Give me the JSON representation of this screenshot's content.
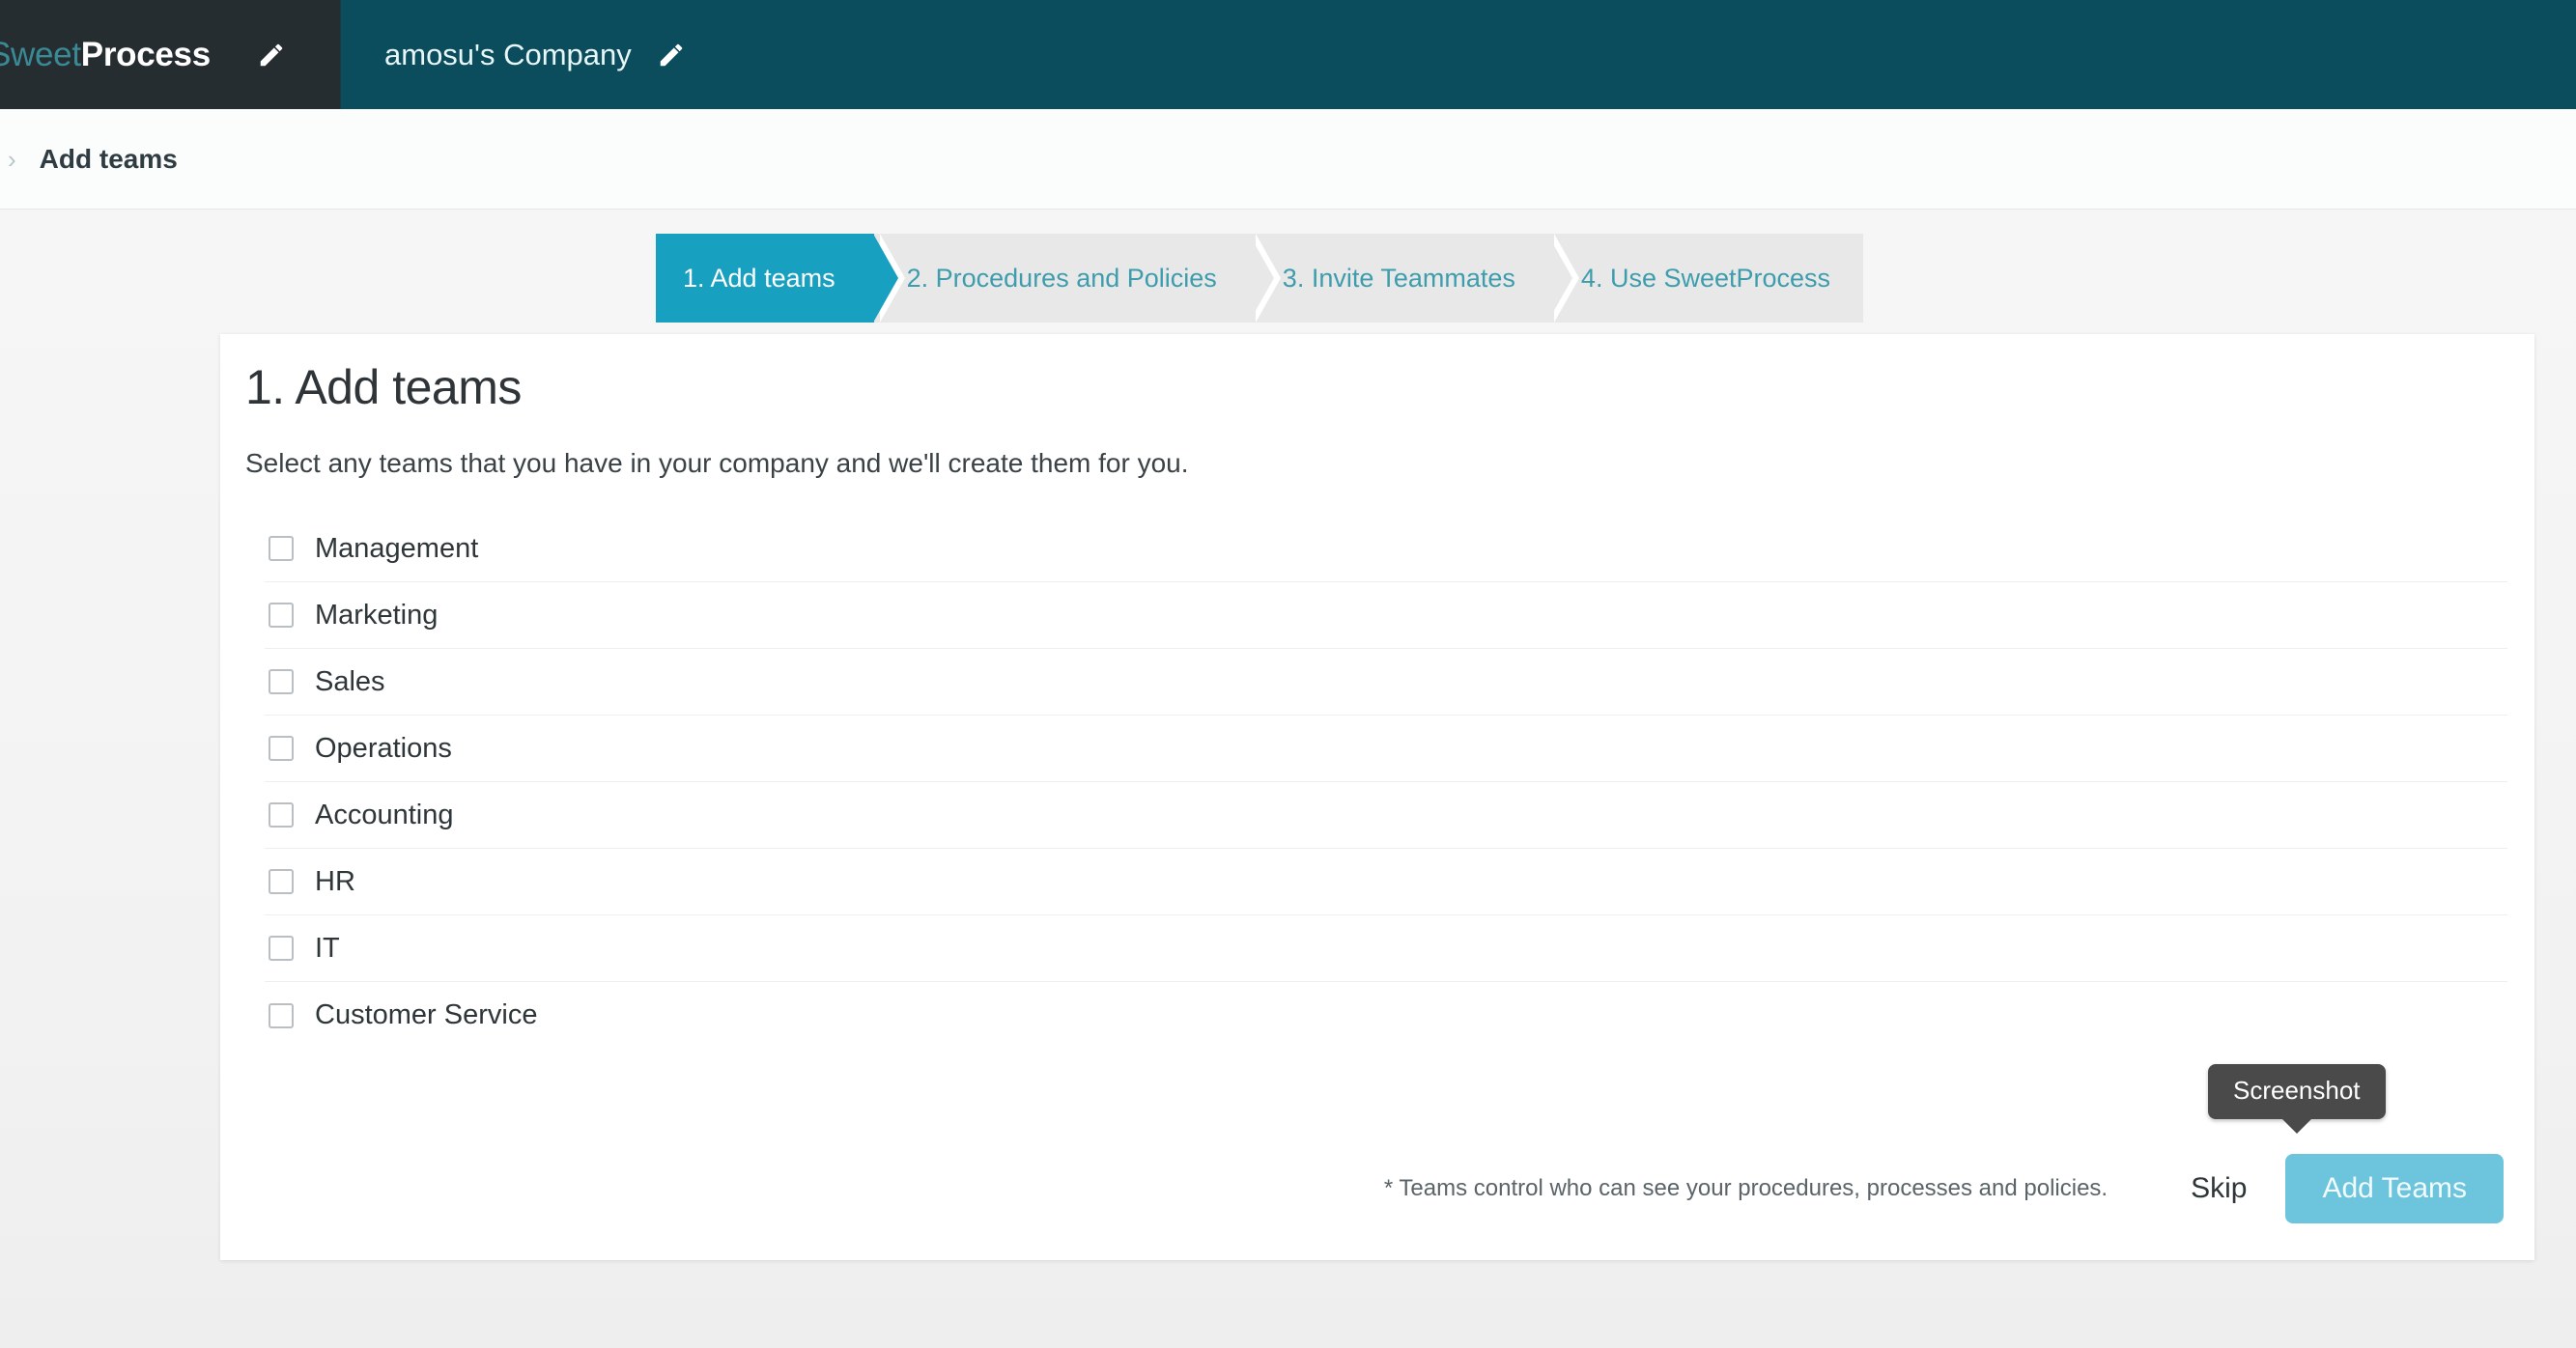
{
  "topbar": {
    "logo": {
      "part1": "Sweet",
      "part2": "Process"
    },
    "logo_edit_icon": "pencil-icon",
    "company_name": "amosu's Company",
    "company_edit_icon": "pencil-icon"
  },
  "breadcrumb": {
    "separator": "›",
    "current": "Add teams"
  },
  "steps": [
    {
      "label": "1. Add teams",
      "active": true
    },
    {
      "label": "2. Procedures and Policies",
      "active": false
    },
    {
      "label": "3. Invite Teammates",
      "active": false
    },
    {
      "label": "4. Use SweetProcess",
      "active": false
    }
  ],
  "card": {
    "title": "1. Add teams",
    "description": "Select any teams that you have in your company and we'll create them for you.",
    "teams": [
      {
        "label": "Management",
        "checked": false
      },
      {
        "label": "Marketing",
        "checked": false
      },
      {
        "label": "Sales",
        "checked": false
      },
      {
        "label": "Operations",
        "checked": false
      },
      {
        "label": "Accounting",
        "checked": false
      },
      {
        "label": "HR",
        "checked": false
      },
      {
        "label": "IT",
        "checked": false
      },
      {
        "label": "Customer Service",
        "checked": false
      }
    ],
    "footnote": "* Teams control who can see your procedures, processes and policies.",
    "skip_label": "Skip",
    "submit_label": "Add Teams"
  },
  "tooltip": {
    "text": "Screenshot"
  },
  "colors": {
    "brand_dark": "#262d31",
    "header_teal": "#0b4d5c",
    "step_active": "#17a0c0",
    "step_inactive_bg": "#e8e8e8",
    "step_inactive_text": "#3d9dad",
    "primary_button": "#6cc5dd",
    "logo_sweet": "#3a8a96",
    "tooltip_bg": "#4a4a4a"
  }
}
